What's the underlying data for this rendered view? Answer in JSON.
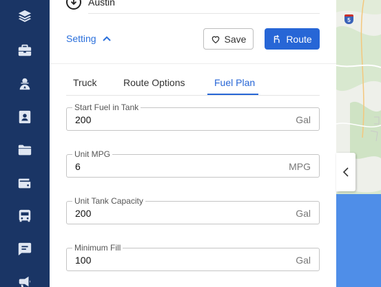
{
  "nav": {
    "items": [
      {
        "icon": "layers-icon"
      },
      {
        "icon": "briefcase-icon"
      },
      {
        "icon": "driver-icon"
      },
      {
        "icon": "contact-card-icon"
      },
      {
        "icon": "folder-icon"
      },
      {
        "icon": "wallet-icon"
      },
      {
        "icon": "bus-icon"
      },
      {
        "icon": "chat-icon"
      },
      {
        "icon": "megaphone-icon"
      }
    ],
    "background": "#1a3565"
  },
  "route": {
    "stop_label": "Austin"
  },
  "setting": {
    "label": "Setting",
    "expanded": true
  },
  "actions": {
    "save_label": "Save",
    "route_label": "Route",
    "accent": "#2766d6"
  },
  "tabs": {
    "items": [
      "Truck",
      "Route Options",
      "Fuel Plan"
    ],
    "active": "Fuel Plan"
  },
  "fuel_plan": {
    "fields": [
      {
        "label": "Start Fuel in Tank",
        "value": "200",
        "unit": "Gal"
      },
      {
        "label": "Unit MPG",
        "value": "6",
        "unit": "MPG"
      },
      {
        "label": "Unit Tank Capacity",
        "value": "200",
        "unit": "Gal"
      },
      {
        "label": "Minimum Fill",
        "value": "100",
        "unit": "Gal"
      }
    ]
  },
  "map": {
    "shield_label": "5",
    "water_color": "#4f8ee8",
    "land_color": "#eef0ea"
  }
}
